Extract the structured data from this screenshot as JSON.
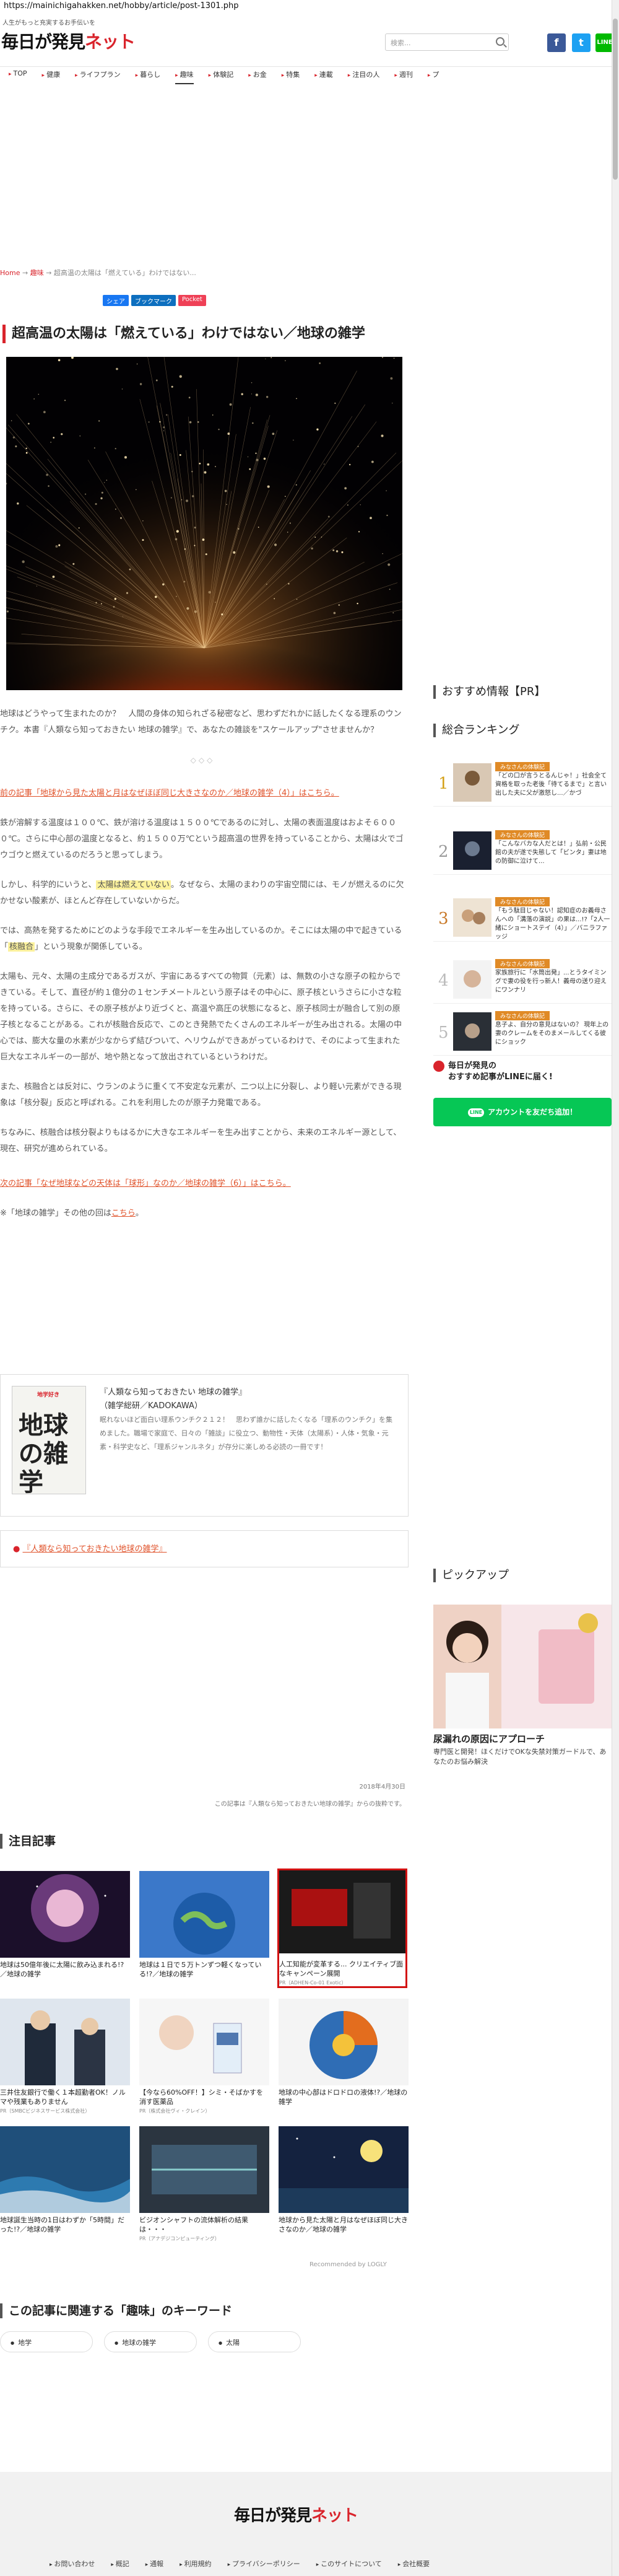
{
  "browser": {
    "url": "https://mainichigahakken.net/hobby/article/post-1301.php"
  },
  "header": {
    "tagline": "人生がもっと充実するお手伝いを",
    "logo_main": "毎日が発見",
    "logo_accent": "ネット",
    "search_placeholder": "検索...",
    "social": {
      "facebook": "f",
      "twitter": "t",
      "line": "LINE"
    }
  },
  "nav": {
    "items": [
      "TOP",
      "健康",
      "ライフプラン",
      "暮らし",
      "趣味",
      "体験記",
      "お金",
      "特集",
      "連載",
      "注目の人",
      "週刊",
      "プ"
    ]
  },
  "breadcrumb": {
    "home": "Home",
    "sep": " → ",
    "category": "趣味",
    "current": "超高温の太陽は「燃えている」わけではない..."
  },
  "share": {
    "facebook": "シェア",
    "hatena": "ブックマーク",
    "pocket": "Pocket"
  },
  "article": {
    "title": "超高温の太陽は「燃えている」わけではない／地球の雑学",
    "intro": "地球はどうやって生まれたのか？　人間の身体の知られざる秘密など、思わずだれかに話したくなる理系のウンチク。本書『人類なら知っておきたい 地球の雑学』で、あなたの雑談を\"スケールアップ\"させませんか？",
    "divider": "◇◇◇",
    "prev_link": "前の記事「地球から見た太陽と月はなぜほぼ同じ大きさなのか／地球の雑学（4）」はこちら。",
    "p1": "鉄が溶解する温度は１００℃、鉄が溶ける温度は１５００℃であるのに対し、太陽の表面温度はおよそ６０００℃。さらに中心部の温度となると、約１５００万℃という超高温の世界を持っていることから、太陽は火でゴウゴウと燃えているのだろうと思ってしまう。",
    "p2_a": "しかし、科学的にいうと、",
    "p2_hl": "太陽は燃えていない",
    "p2_b": "。なぜなら、太陽のまわりの宇宙空間には、モノが燃えるのに欠かせない酸素が、ほとんど存在していないからだ。",
    "p3_a": "では、高熱を発するためにどのような手段でエネルギーを生み出しているのか。そこには太陽の中で起きている「",
    "p3_hl": "核融合",
    "p3_b": "」という現象が関係している。",
    "p4": "太陽も、元々、太陽の主成分であるガスが、宇宙にあるすべての物質（元素）は、無数の小さな原子の粒からできている。そして、直径が約１億分の１センチメートルという原子はその中心に、原子核というさらに小さな粒を持っている。さらに、その原子核がより近づくと、高温や高圧の状態になると、原子核同士が融合して別の原子核となることがある。これが核融合反応で、このとき発熱でたくさんのエネルギーが生み出される。太陽の中心では、膨大な量の水素が少なからず結びついて、ヘリウムができあがっているわけで、そのによって生まれた巨大なエネルギーの一部が、地や熱となって放出されているというわけだ。",
    "p5": "また、核融合とは反対に、ウランのように重くて不安定な元素が、二つ以上に分裂し、より軽い元素ができる現象は「核分裂」反応と呼ばれる。これを利用したのが原子力発電である。",
    "p6": "ちなみに、核融合は核分裂よりもはるかに大きなエネルギーを生み出すことから、未来のエネルギー源として、現在、研究が進められている。",
    "next_link": "次の記事「なぜ地球などの天体は「球形」なのか／地球の雑学（6）」はこちら。",
    "first_prefix": "※「地球の雑学」その他の回は",
    "first_link": "こちら",
    "first_suffix": "。"
  },
  "book": {
    "cover_top": "地学好き",
    "cover_title": "地球の雑学",
    "title": "『人類なら知っておきたい 地球の雑学』",
    "meta": "（雑学総研／KADOKAWA）",
    "desc": "眠れないほど面白い理系ウンチク２１２！　思わず誰かに話したくなる「理系のウンチク」を集めました。職場で家庭で、日々の「雑談」に役立つ、動物性・天体（太陽系）・人体・気象・元素・科学史など、「理系ジャンルネタ」が存分に楽しめる必読の一冊です！"
  },
  "related": {
    "bullet": "●",
    "title": "『人類なら知っておきたい地球の雑学』"
  },
  "meta": {
    "date": "2018年4月30日",
    "source": "この記事は『人類なら知っておきたい地球の雑学』からの抜粋です。"
  },
  "featured": {
    "heading": "注目記事",
    "cards": [
      {
        "title": "地球は50億年後に太陽に飲み込まれる!?／地球の雑学",
        "pr": ""
      },
      {
        "title": "地球は１日で５万トンずつ軽くなっている!?／地球の雑学",
        "pr": ""
      },
      {
        "title": "人工知能が変革する... クリエイティブ面なキャンペーン展開",
        "pr": "PR（ADHEN-Co-01 Exotic）"
      },
      {
        "title": "三井住友銀行で働く１本超勤者OK！ノルマや残業もありません",
        "pr": "PR（SMBCビジネスサービス株式会社）"
      },
      {
        "title": "【今なら60%OFF！】シミ・そばかすを消す医薬品",
        "pr": "PR（株式会社ヴィ・クレイン）"
      },
      {
        "title": "地球の中心部はドロドロの液体!?／地球の雑学",
        "pr": ""
      },
      {
        "title": "地球誕生当時の1日はわずか「5時間」だった!?／地球の雑学",
        "pr": ""
      },
      {
        "title": "ビジオンシャフトの流体解析の結果は・・・",
        "pr": "PR（アナデジコンピューティング）"
      },
      {
        "title": "地球から見た太陽と月はなぜほぼ同じ大きさなのか／地球の雑学",
        "pr": ""
      }
    ],
    "recommended_by": "Recommended by LOGLY"
  },
  "keywords": {
    "heading": "この記事に関連する「趣味」のキーワード",
    "items": [
      "地学",
      "地球の雑学",
      "太陽"
    ]
  },
  "sidebar": {
    "recommend_heading": "おすすめ情報【PR】",
    "ranking_heading": "総合ランキング",
    "ranking": [
      {
        "num": "1",
        "tag": "みなさんの体験記",
        "text": "「どの口が言うとるんじゃ！」社会全て資格を取った老後「待てるまで」と言い出した夫に父が激怒し...／かづ"
      },
      {
        "num": "2",
        "tag": "みなさんの体験記",
        "text": "「こんなバカな人だとは！」弘前・公民館の夫が遂で失態して「ビンタ」妻は地の防御に泣けて..."
      },
      {
        "num": "3",
        "tag": "みなさんの体験記",
        "text": "「もう駄目じゃない！認知症のお義母さんへの「溝落の演説」の果は...!?「2人一緒にショートステイ（4）」／バニラファッジ"
      },
      {
        "num": "4",
        "tag": "みなさんの体験記",
        "text": "家族旅行に「水筒出発」...とうタイミングで妻の役を行っ新人！義母の送り迎えにワンナリ"
      },
      {
        "num": "5",
        "tag": "みなさんの体験記",
        "text": "息子よ、自分の意見はないの？ 現年上の妻のクレームをそのまメールしてくる彼にショック"
      }
    ],
    "line_title": "毎日が発見の\nおすすめ記事がLINEに届く!",
    "line_btn_badge": "LINE",
    "line_btn": "アカウントを友だち追加！",
    "pickup_heading": "ピックアップ",
    "pickup_caption": "尿漏れの原因にアプローチ",
    "pickup_sub": "専門医と開発！ほくだけでOKな失禁対策ガードルで、あなたのお悩み解決"
  },
  "footer": {
    "logo_main": "毎日が発見",
    "logo_accent": "ネット",
    "links": [
      "お問い合わせ",
      "概記",
      "通報",
      "利用規約",
      "プライバシーポリシー",
      "このサイトについて",
      "会社概要"
    ]
  },
  "colors": {
    "accent": "#d9242c",
    "link": "#e0522a",
    "line_green": "#06c755",
    "highlight": "#fcf29d"
  }
}
